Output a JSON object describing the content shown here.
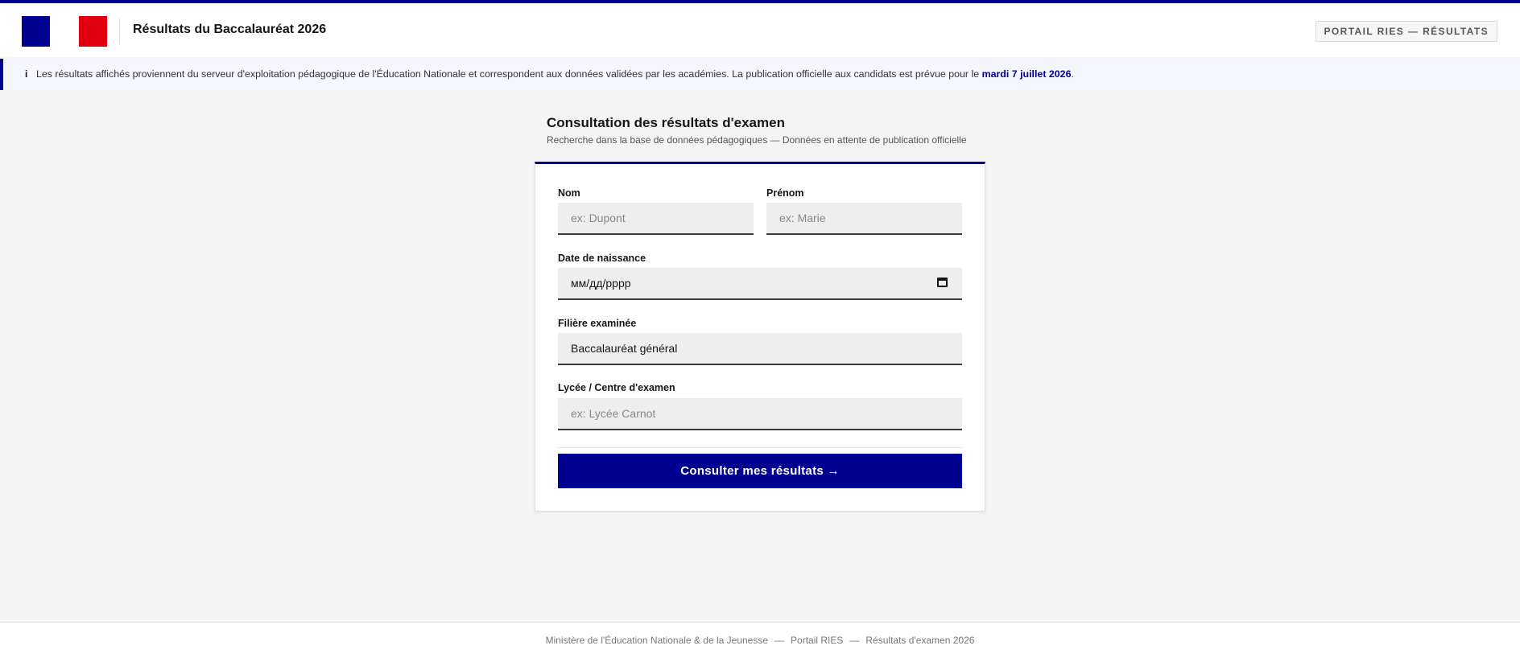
{
  "header": {
    "title": "Résultats du Baccalauréat 2026",
    "portal_badge": "PORTAIL RIES — RÉSULTATS"
  },
  "notice": {
    "icon": "info-icon",
    "text": "Les résultats affichés proviennent du serveur d'exploitation pédagogique de l'Éducation Nationale et correspondent aux données validées par les académies. La publication officielle aux candidats est prévue pour le ",
    "date": "mardi 7 juillet 2026",
    "suffix": "."
  },
  "form": {
    "title": "Consultation des résultats d'examen",
    "subtitle": "Recherche dans la base de données pédagogiques — Données en attente de publication officielle",
    "nom": {
      "label": "Nom",
      "placeholder": "ex: Dupont"
    },
    "prenom": {
      "label": "Prénom",
      "placeholder": "ex: Marie"
    },
    "naissance": {
      "label": "Date de naissance",
      "value": "мм/дд/рррр"
    },
    "filiere": {
      "label": "Filière examinée",
      "value": "Baccalauréat général"
    },
    "lycee": {
      "label": "Lycée / Centre d'examen",
      "placeholder": "ex: Lycée Carnot"
    },
    "submit_label": "Consulter mes résultats →"
  },
  "footer": {
    "items": [
      "Ministère de l'Éducation Nationale & de la Jeunesse",
      "Portail RIES",
      "Résultats d'examen 2026"
    ],
    "separator": "—"
  },
  "colors": {
    "accent": "#000091",
    "flag_red": "#e1000f"
  }
}
